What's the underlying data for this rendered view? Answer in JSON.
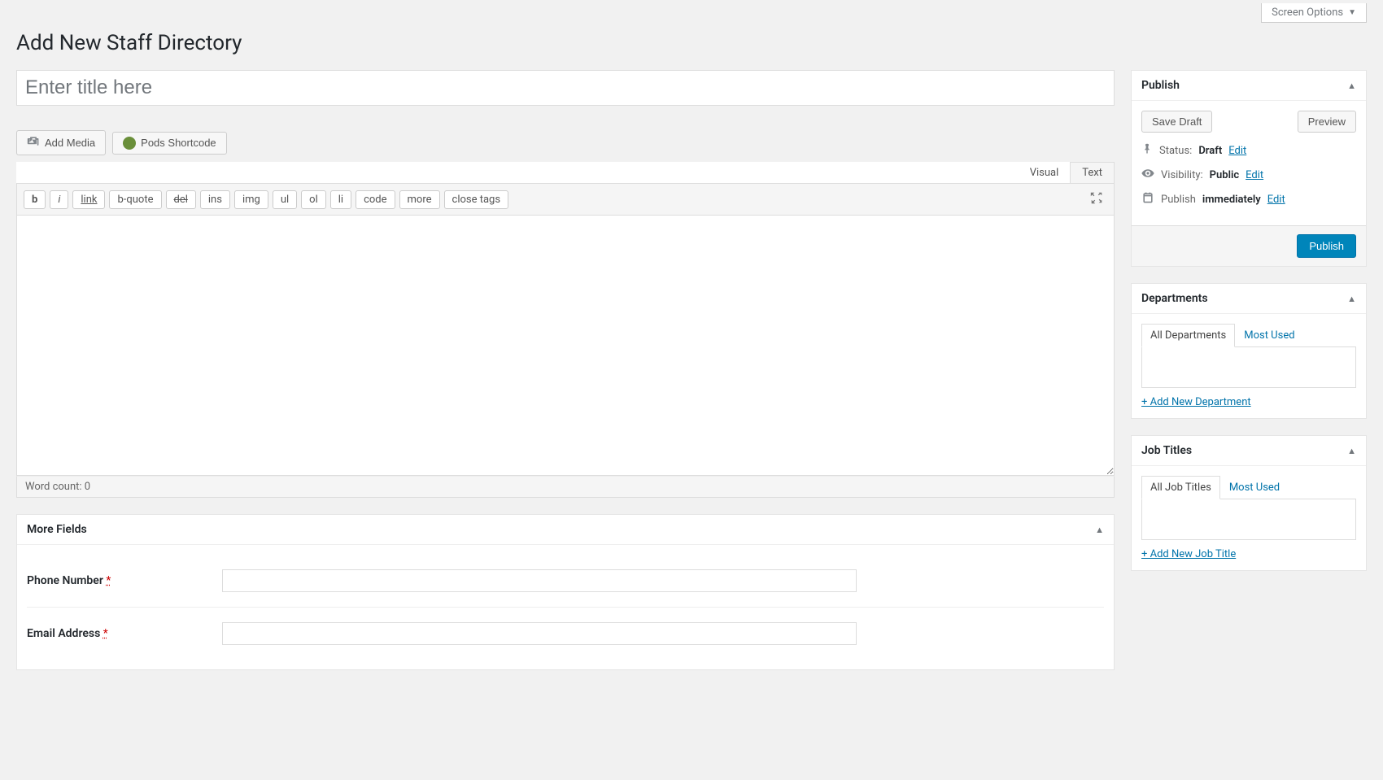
{
  "screen_options_label": "Screen Options",
  "page_title": "Add New Staff Directory",
  "title_placeholder": "Enter title here",
  "media_buttons": {
    "add_media": "Add Media",
    "pods_shortcode": "Pods Shortcode"
  },
  "editor": {
    "tabs": {
      "visual": "Visual",
      "text": "Text"
    },
    "quicktags": {
      "b": "b",
      "i": "i",
      "link": "link",
      "bquote": "b-quote",
      "del": "del",
      "ins": "ins",
      "img": "img",
      "ul": "ul",
      "ol": "ol",
      "li": "li",
      "code": "code",
      "more": "more",
      "close": "close tags"
    },
    "word_count_label": "Word count: ",
    "word_count": "0"
  },
  "more_fields": {
    "title": "More Fields",
    "phone_label": "Phone Number",
    "email_label": "Email Address",
    "required_mark": "*"
  },
  "publish": {
    "title": "Publish",
    "save_draft": "Save Draft",
    "preview": "Preview",
    "status_label": "Status:",
    "status_value": "Draft",
    "visibility_label": "Visibility:",
    "visibility_value": "Public",
    "publish_label": "Publish",
    "publish_value": "immediately",
    "edit": "Edit",
    "publish_button": "Publish"
  },
  "departments": {
    "title": "Departments",
    "tab_all": "All Departments",
    "tab_most": "Most Used",
    "add_new": "+ Add New Department"
  },
  "job_titles": {
    "title": "Job Titles",
    "tab_all": "All Job Titles",
    "tab_most": "Most Used",
    "add_new": "+ Add New Job Title"
  }
}
